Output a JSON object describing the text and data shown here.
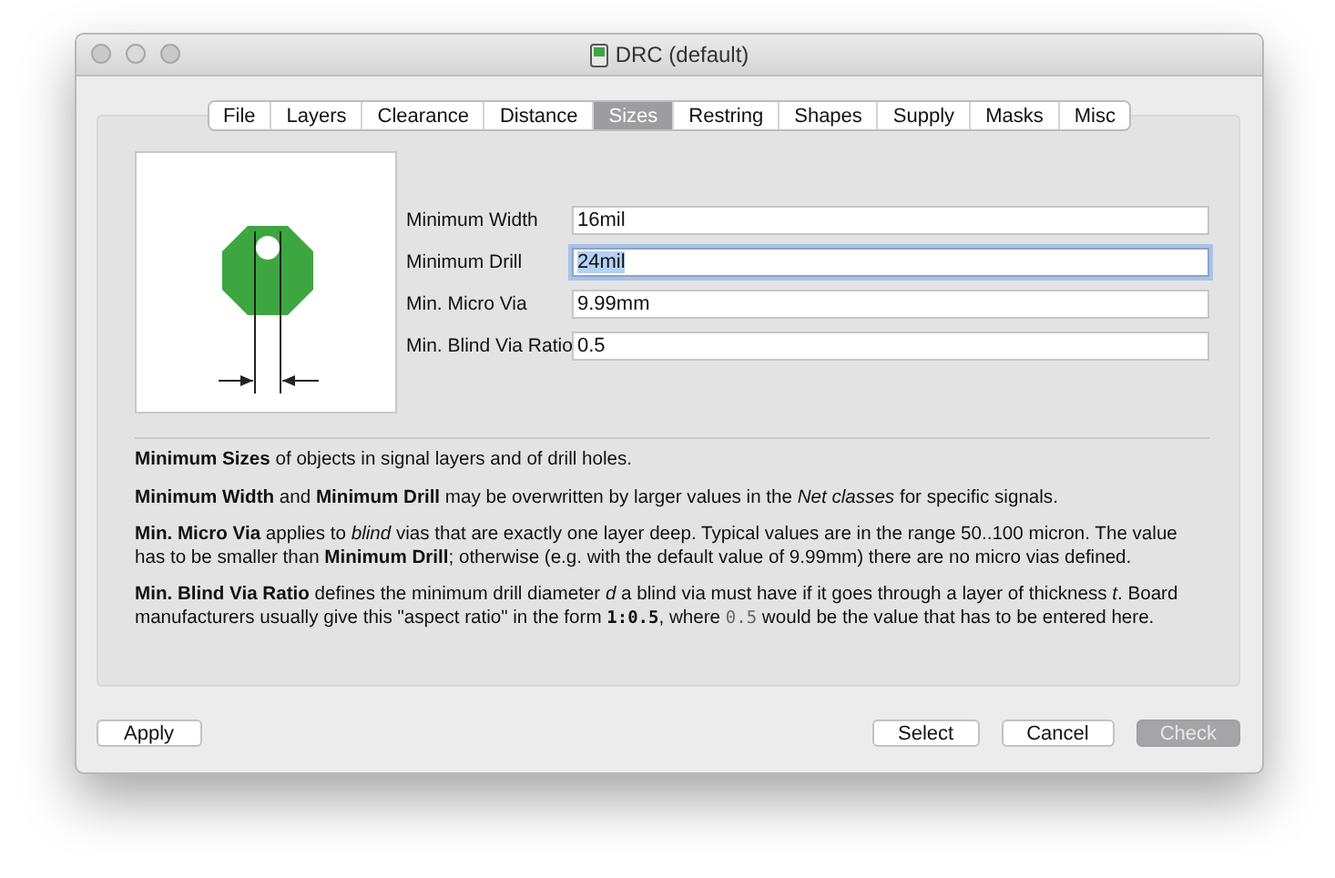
{
  "window": {
    "title": "DRC (default)"
  },
  "tabs": [
    {
      "label": "File",
      "selected": false
    },
    {
      "label": "Layers",
      "selected": false
    },
    {
      "label": "Clearance",
      "selected": false
    },
    {
      "label": "Distance",
      "selected": false
    },
    {
      "label": "Sizes",
      "selected": true
    },
    {
      "label": "Restring",
      "selected": false
    },
    {
      "label": "Shapes",
      "selected": false
    },
    {
      "label": "Supply",
      "selected": false
    },
    {
      "label": "Masks",
      "selected": false
    },
    {
      "label": "Misc",
      "selected": false
    }
  ],
  "fields": [
    {
      "label": "Minimum Width",
      "value": "16mil",
      "focused": false
    },
    {
      "label": "Minimum Drill",
      "value": "24mil",
      "focused": true
    },
    {
      "label": "Min. Micro Via",
      "value": "9.99mm",
      "focused": false
    },
    {
      "label": "Min. Blind Via Ratio",
      "value": "0.5",
      "focused": false
    }
  ],
  "help": [
    [
      {
        "kind": "text",
        "text": "**Minimum Sizes** of objects in signal layers and of drill holes."
      }
    ],
    [
      {
        "kind": "text",
        "text": "**Minimum Width** and **Minimum Drill** may be overwritten by larger values in the *Net classes* for specific signals."
      }
    ],
    [
      {
        "kind": "text",
        "text": "**Min. Micro Via** applies to *blind* vias that are exactly one layer deep. Typical values are in the range 50..100 micron. The value has to be smaller than **Minimum Drill**; otherwise (e.g. with the default value of 9.99mm) there are no micro vias defined."
      }
    ],
    [
      {
        "kind": "text",
        "text": "**Min. Blind Via Ratio** defines the minimum drill diameter *d* a blind via must have if it goes through a layer of thickness *t*. Board manufacturers usually give this \"aspect ratio\" in the form "
      },
      {
        "kind": "code",
        "text": "1:0.5"
      },
      {
        "kind": "text",
        "text": ", where "
      },
      {
        "kind": "code-light",
        "text": "0.5"
      },
      {
        "kind": "text",
        "text": " would be the value that has to be entered here."
      }
    ]
  ],
  "left_buttons": [
    {
      "label": "Apply",
      "disabled": false
    }
  ],
  "right_buttons": [
    {
      "label": "Select",
      "disabled": false
    },
    {
      "label": "Cancel",
      "disabled": false
    },
    {
      "label": "Check",
      "disabled": true
    }
  ]
}
